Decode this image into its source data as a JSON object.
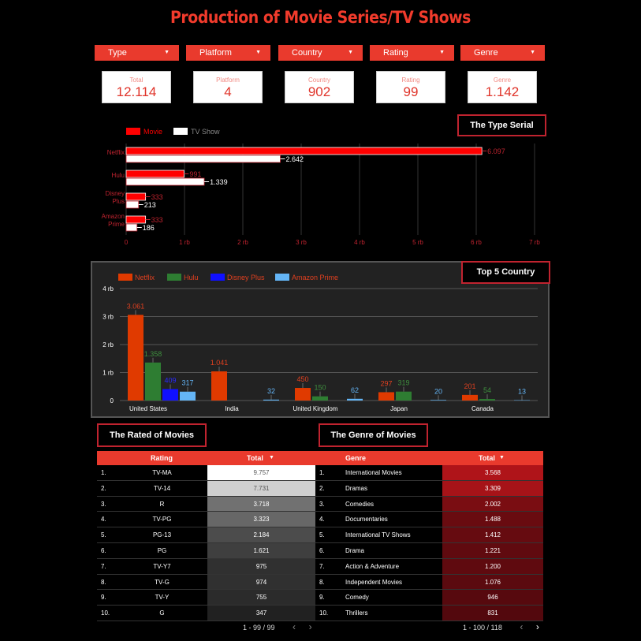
{
  "title": "Production of Movie Series/TV Shows",
  "filters": [
    {
      "label": "Type"
    },
    {
      "label": "Platform"
    },
    {
      "label": "Country"
    },
    {
      "label": "Rating"
    },
    {
      "label": "Genre"
    }
  ],
  "kpis": [
    {
      "label": "Total",
      "value": "12.114"
    },
    {
      "label": "Platform",
      "value": "4"
    },
    {
      "label": "Country",
      "value": "902"
    },
    {
      "label": "Rating",
      "value": "99"
    },
    {
      "label": "Genre",
      "value": "1.142"
    }
  ],
  "labels": {
    "type_serial": "The Type Serial",
    "top5": "Top 5 Country",
    "rated": "The Rated of Movies",
    "genre": "The Genre of Movies"
  },
  "colors": {
    "accent": "#e93a2d",
    "movie": "#ff0000",
    "tvshow": "#ffffff",
    "netflix": "#e03a00",
    "hulu": "#2e7d32",
    "disney": "#1010ff",
    "amazon": "#64b5f6"
  },
  "chart_data": [
    {
      "type": "bar",
      "orientation": "horizontal",
      "categories": [
        "Netflix",
        "Hulu",
        "Disney Plus",
        "Amazon Prime"
      ],
      "series": [
        {
          "name": "Movie",
          "values": [
            6097,
            991,
            333,
            333
          ],
          "labels": [
            "6.097",
            "991",
            "333",
            "333"
          ]
        },
        {
          "name": "TV Show",
          "values": [
            2642,
            1339,
            213,
            186
          ],
          "labels": [
            "2.642",
            "1.339",
            "213",
            "186"
          ]
        }
      ],
      "x_ticks": [
        "0",
        "1 rb",
        "2 rb",
        "3 rb",
        "4 rb",
        "5 rb",
        "6 rb",
        "7 rb"
      ],
      "xlim": [
        0,
        7000
      ],
      "legend": "top-left"
    },
    {
      "type": "bar",
      "categories": [
        "United States",
        "India",
        "United Kingdom",
        "Japan",
        "Canada"
      ],
      "series": [
        {
          "name": "Netflix",
          "values": [
            3061,
            1041,
            450,
            297,
            201
          ],
          "labels": [
            "3.061",
            "1.041",
            "450",
            "297",
            "201"
          ]
        },
        {
          "name": "Hulu",
          "values": [
            1358,
            0,
            150,
            319,
            54
          ],
          "labels": [
            "1.358",
            "",
            "150",
            "319",
            "54"
          ]
        },
        {
          "name": "Disney Plus",
          "values": [
            409,
            0,
            0,
            0,
            0
          ],
          "labels": [
            "409",
            "",
            "",
            "",
            ""
          ]
        },
        {
          "name": "Amazon Prime",
          "values": [
            317,
            32,
            62,
            20,
            13
          ],
          "labels": [
            "317",
            "32",
            "62",
            "20",
            "13"
          ]
        }
      ],
      "y_ticks": [
        "0",
        "1 rb",
        "2 rb",
        "3 rb",
        "4 rb"
      ],
      "ylim": [
        0,
        4000
      ],
      "legend": "top-left"
    }
  ],
  "rated_table": {
    "headers": [
      "Rating",
      "Total"
    ],
    "sort_indicator": "▼",
    "rows": [
      {
        "num": "1.",
        "rating": "TV-MA",
        "total": "9.757",
        "value": 9757
      },
      {
        "num": "2.",
        "rating": "TV-14",
        "total": "7.731",
        "value": 7731
      },
      {
        "num": "3.",
        "rating": "R",
        "total": "3.718",
        "value": 3718
      },
      {
        "num": "4.",
        "rating": "TV-PG",
        "total": "3.323",
        "value": 3323
      },
      {
        "num": "5.",
        "rating": "PG-13",
        "total": "2.184",
        "value": 2184
      },
      {
        "num": "6.",
        "rating": "PG",
        "total": "1.621",
        "value": 1621
      },
      {
        "num": "7.",
        "rating": "TV-Y7",
        "total": "975",
        "value": 975
      },
      {
        "num": "8.",
        "rating": "TV-G",
        "total": "974",
        "value": 974
      },
      {
        "num": "9.",
        "rating": "TV-Y",
        "total": "755",
        "value": 755
      },
      {
        "num": "10.",
        "rating": "G",
        "total": "347",
        "value": 347
      }
    ],
    "pager": "1 - 99 / 99"
  },
  "genre_table": {
    "headers": [
      "Genre",
      "Total"
    ],
    "sort_indicator": "▼",
    "rows": [
      {
        "num": "1.",
        "genre": "International Movies",
        "total": "3.568",
        "value": 3568
      },
      {
        "num": "2.",
        "genre": "Dramas",
        "total": "3.309",
        "value": 3309
      },
      {
        "num": "3.",
        "genre": "Comedies",
        "total": "2.002",
        "value": 2002
      },
      {
        "num": "4.",
        "genre": "Documentaries",
        "total": "1.488",
        "value": 1488
      },
      {
        "num": "5.",
        "genre": "International TV Shows",
        "total": "1.412",
        "value": 1412
      },
      {
        "num": "6.",
        "genre": "Drama",
        "total": "1.221",
        "value": 1221
      },
      {
        "num": "7.",
        "genre": "Action & Adventure",
        "total": "1.200",
        "value": 1200
      },
      {
        "num": "8.",
        "genre": "Independent Movies",
        "total": "1.076",
        "value": 1076
      },
      {
        "num": "9.",
        "genre": "Comedy",
        "total": "946",
        "value": 946
      },
      {
        "num": "10.",
        "genre": "Thrillers",
        "total": "831",
        "value": 831
      }
    ],
    "pager": "1 - 100 / 118"
  },
  "icons": {
    "caret": "dropdown-caret-icon",
    "prev": "chevron-left-icon",
    "next": "chevron-right-icon"
  }
}
